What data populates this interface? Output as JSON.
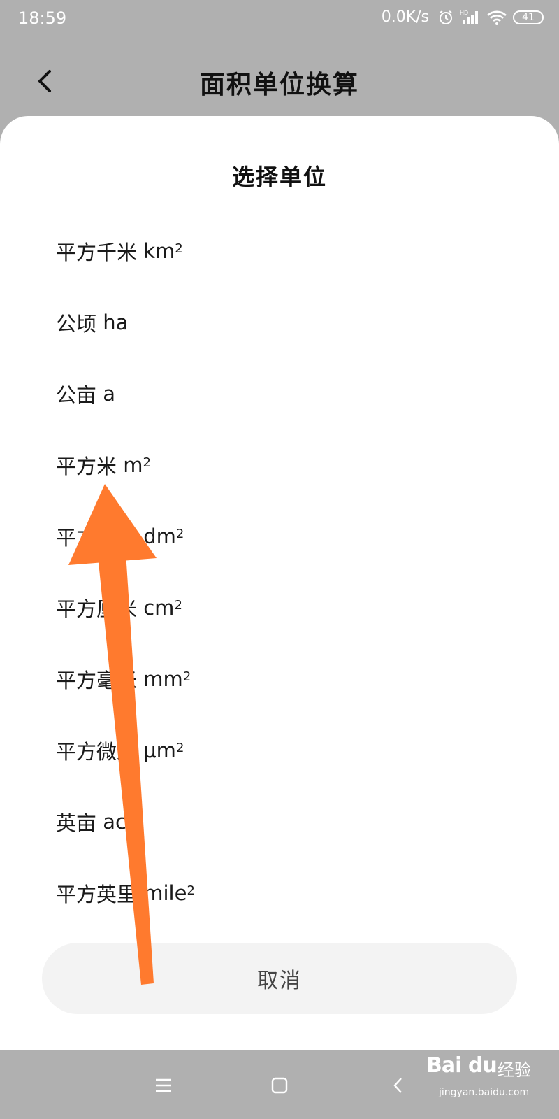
{
  "status_bar": {
    "time": "18:59",
    "net_speed": "0.0K/s",
    "battery": "41",
    "signal_label": "HD"
  },
  "header": {
    "title": "面积单位换算"
  },
  "sheet": {
    "title": "选择单位",
    "units": [
      {
        "name": "平方千米",
        "symbol": "km",
        "sup": "2"
      },
      {
        "name": "公顷",
        "symbol": "ha",
        "sup": ""
      },
      {
        "name": "公亩",
        "symbol": "a",
        "sup": ""
      },
      {
        "name": "平方米",
        "symbol": "m",
        "sup": "2"
      },
      {
        "name": "平方分米",
        "symbol": "dm",
        "sup": "2"
      },
      {
        "name": "平方厘米",
        "symbol": "cm",
        "sup": "2"
      },
      {
        "name": "平方毫米",
        "symbol": "mm",
        "sup": "2"
      },
      {
        "name": "平方微米",
        "symbol": "μm",
        "sup": "2"
      },
      {
        "name": "英亩",
        "symbol": "ac",
        "sup": ""
      },
      {
        "name": "平方英里",
        "symbol": "mile",
        "sup": "2"
      }
    ],
    "cancel_label": "取消"
  },
  "watermark": {
    "logo": "Bai du",
    "text": "经验",
    "url": "jingyan.baidu.com"
  },
  "colors": {
    "background_dim": "#b0b0b0",
    "sheet": "#ffffff",
    "arrow": "#ff7a2e",
    "cancel_bg": "#f3f3f3"
  },
  "icons": {
    "back": "chevron-left-icon",
    "alarm": "alarm-icon",
    "signal": "signal-icon",
    "wifi": "wifi-icon",
    "battery": "battery-icon",
    "nav_menu": "menu-icon",
    "nav_home": "home-square-icon",
    "nav_back": "back-chevron-icon"
  }
}
